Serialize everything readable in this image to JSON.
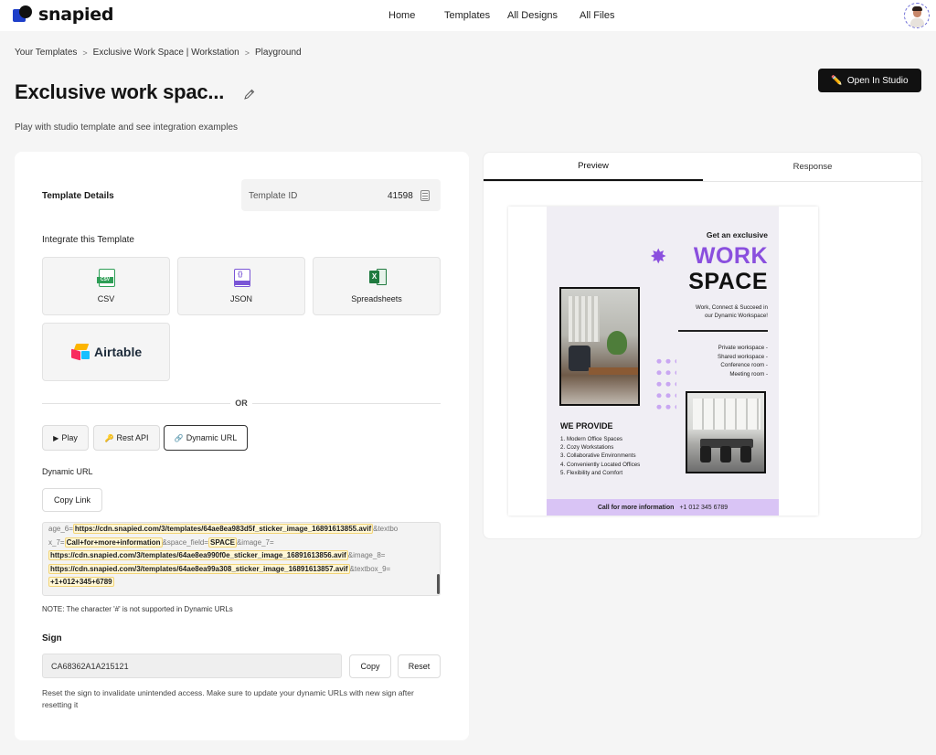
{
  "brand": {
    "name": "snapied",
    "accent": "#1e3fc9"
  },
  "nav": {
    "home": "Home",
    "templates": "Templates",
    "all_designs": "All Designs",
    "all_files": "All Files"
  },
  "breadcrumb": {
    "item1": "Your Templates",
    "item2": "Exclusive Work Space | Workstation",
    "item3": "Playground",
    "sep": ">"
  },
  "page": {
    "title": "Exclusive work spac...",
    "subtitle": "Play with studio template and see integration examples",
    "open_studio": "Open In Studio",
    "open_studio_icon": "✏️"
  },
  "details": {
    "label": "Template Details",
    "template_id_label": "Template ID",
    "template_id": "41598"
  },
  "integrate": {
    "label": "Integrate this Template",
    "csv": "CSV",
    "csv_badge": "CSV",
    "json": "JSON",
    "spreadsheets": "Spreadsheets",
    "xls_letter": "X",
    "airtable": "Airtable",
    "or": "OR"
  },
  "modes": {
    "play": "Play",
    "play_icon": "▶",
    "rest": "Rest API",
    "rest_icon": "🔑",
    "dynamic": "Dynamic URL",
    "dynamic_icon": "🔗"
  },
  "dynamic_url": {
    "label": "Dynamic URL",
    "copy_link": "Copy Link",
    "l1_pre": "age_6=",
    "l1_hl": "https://cdn.snapied.com/3/templates/64ae8ea983d5f_sticker_image_16891613855.avif",
    "l1_post": "&textbo",
    "l2_pre": "x_7=",
    "l2_hl": "Call+for+more+information",
    "l2_mid": "&space_field=",
    "l2_hl2": "SPACE",
    "l2_post": "&image_7=",
    "l3_hl": "https://cdn.snapied.com/3/templates/64ae8ea990f0e_sticker_image_16891613856.avif",
    "l3_post": "&image_8=",
    "l4_hl": "https://cdn.snapied.com/3/templates/64ae8ea99a308_sticker_image_16891613857.avif",
    "l4_post": "&textbox_9=",
    "l5_hl": "+1+012+345+6789",
    "note": "NOTE: The character '#' is not supported in Dynamic URLs"
  },
  "sign": {
    "label": "Sign",
    "value": "CA68362A1A215121",
    "copy": "Copy",
    "reset": "Reset",
    "help": "Reset the sign to invalidate unintended access. Make sure to update your dynamic URLs with new sign after resetting it"
  },
  "preview_tabs": {
    "preview": "Preview",
    "response": "Response"
  },
  "poster": {
    "get": "Get an exclusive",
    "work": "WORK",
    "space": "SPACE",
    "star": "✸",
    "tagline1": "Work, Connect & Succeed in",
    "tagline2": "our Dynamic Workspace!",
    "list1": "Private workspace -",
    "list2": "Shared workspace -",
    "list3": "Conference room -",
    "list4": "Meeting room -",
    "provide": "WE PROVIDE",
    "s1": "1. Modern Office Spaces",
    "s2": "2. Cozy Workstations",
    "s3": "3. Collaborative Environments",
    "s4": "4. Conveniently Located Offices",
    "s5": "5. Flexibility and Comfort",
    "footer_text": "Call for more information",
    "footer_phone": "+1 012 345 6789",
    "purple": "#8a4fde"
  }
}
